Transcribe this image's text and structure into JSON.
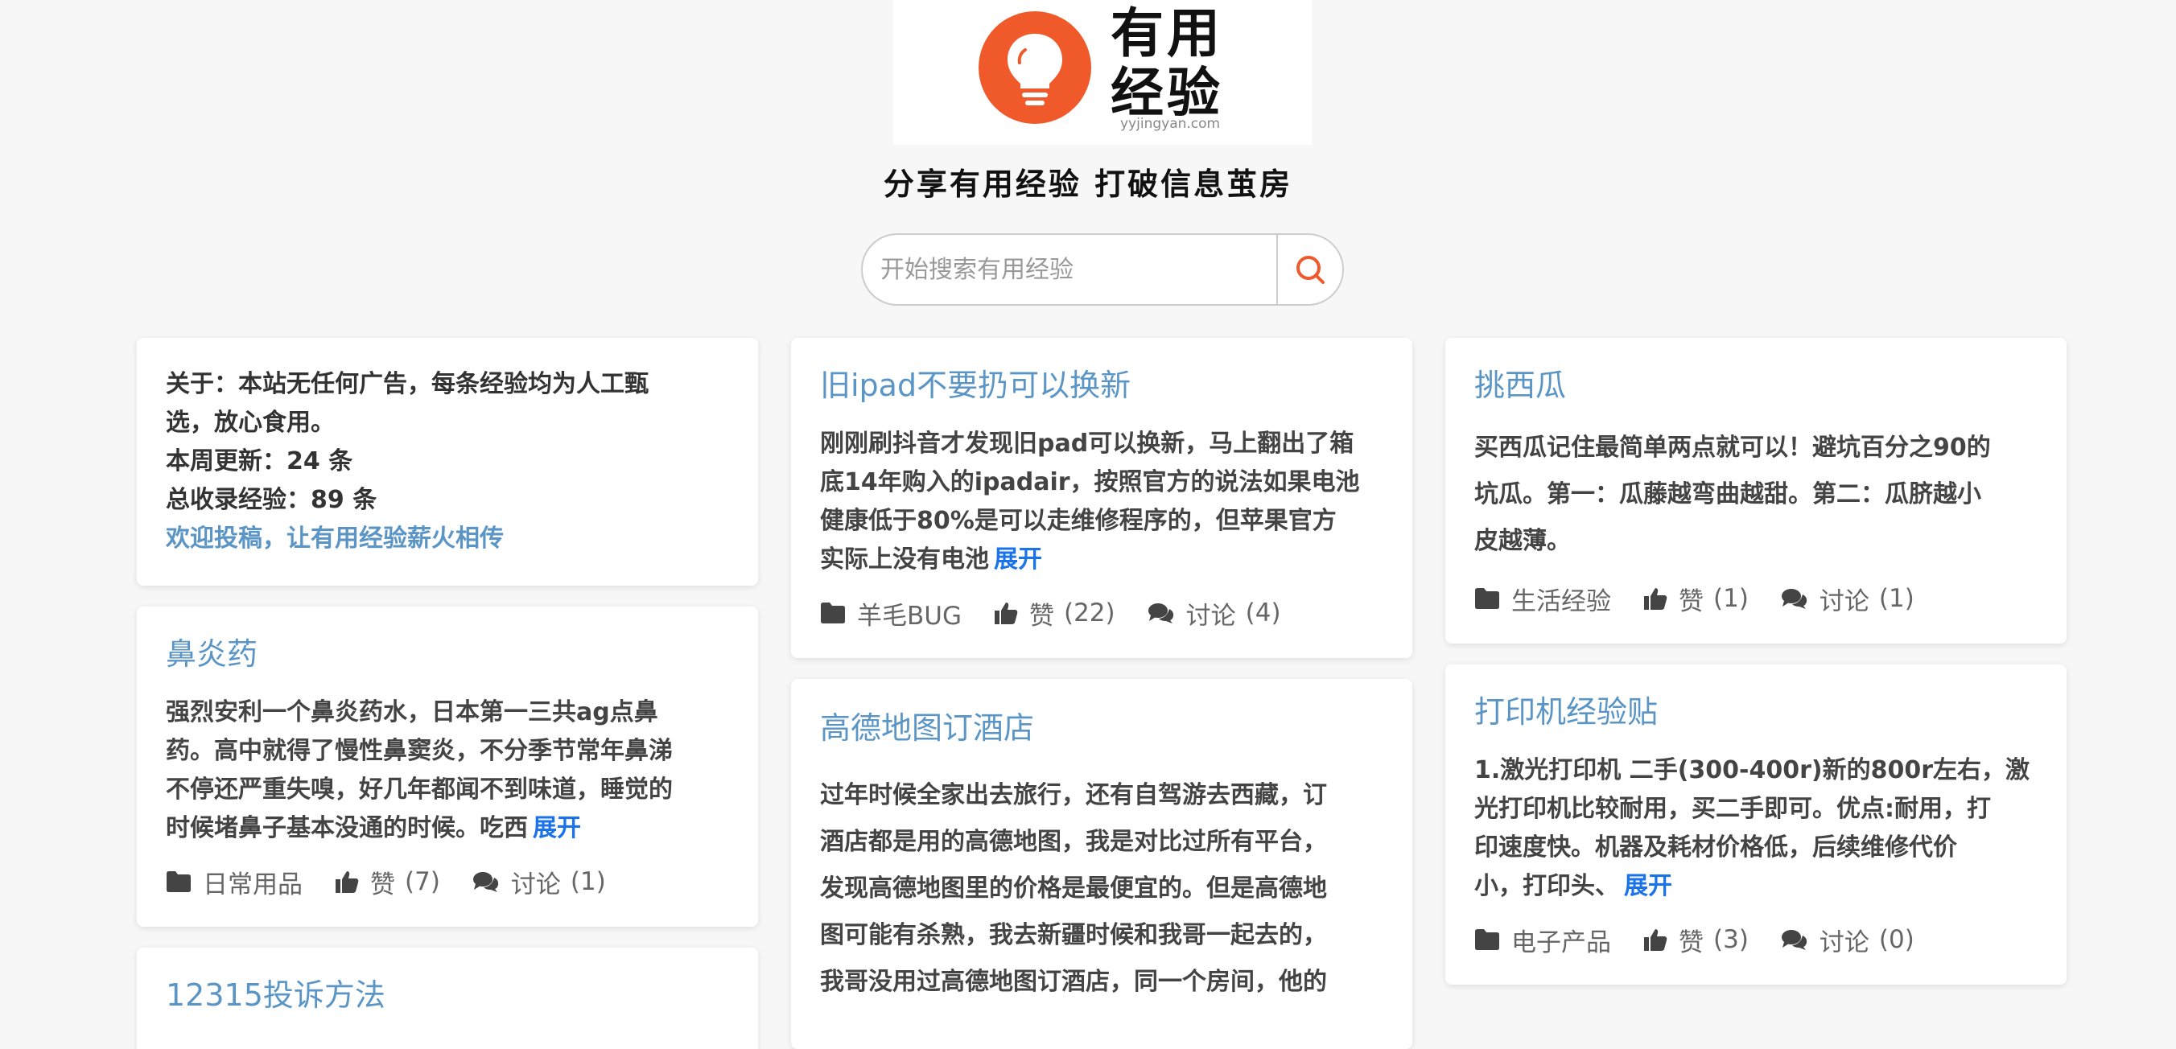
{
  "header": {
    "logo_line1": "有用",
    "logo_line2": "经验",
    "domain": "yyjingyan.com",
    "slogan": "分享有用经验 打破信息茧房"
  },
  "search": {
    "placeholder": "开始搜索有用经验",
    "icon": "search-icon"
  },
  "about": {
    "line1": "关于：本站无任何广告，每条经验均为人工甄",
    "line2": "选，放心食用。",
    "weekly": "本周更新：24 条",
    "total": "总收录经验：89 条",
    "link": "欢迎投稿，让有用经验薪火相传"
  },
  "cards": {
    "c1": {
      "title": "鼻炎药",
      "lines": [
        "强烈安利一个鼻炎药水，日本第一三共ag点鼻",
        "药。高中就得了慢性鼻窦炎，不分季节常年鼻涕",
        "不停还严重失嗅，好几年都闻不到味道，睡觉的",
        "时候堵鼻子基本没通的时候。吃西"
      ],
      "expand": "展开",
      "category": "日常用品",
      "like_label": "赞",
      "likes": "(7)",
      "comment_label": "讨论",
      "comments": "(1)"
    },
    "c2": {
      "title": "12315投诉方法"
    },
    "c3": {
      "title": "旧ipad不要扔可以换新",
      "lines": [
        "刚刚刷抖音才发现旧pad可以换新，马上翻出了箱",
        "底14年购入的ipadair，按照官方的说法如果电池",
        "健康低于80%是可以走维修程序的，但苹果官方",
        "实际上没有电池"
      ],
      "expand": "展开",
      "category": "羊毛BUG",
      "like_label": "赞",
      "likes": "(22)",
      "comment_label": "讨论",
      "comments": "(4)"
    },
    "c4": {
      "title": "高德地图订酒店",
      "lines": [
        "过年时候全家出去旅行，还有自驾游去西藏，订",
        "酒店都是用的高德地图，我是对比过所有平台，",
        "发现高德地图里的价格是最便宜的。但是高德地",
        "图可能有杀熟，我去新疆时候和我哥一起去的，",
        "我哥没用过高德地图订酒店，同一个房间，他的"
      ]
    },
    "c5": {
      "title": "挑西瓜",
      "lines": [
        "买西瓜记住最简单两点就可以！避坑百分之90的",
        "坑瓜。第一：瓜藤越弯曲越甜。第二：瓜脐越小",
        "皮越薄。"
      ],
      "category": "生活经验",
      "like_label": "赞",
      "likes": "(1)",
      "comment_label": "讨论",
      "comments": "(1)"
    },
    "c6": {
      "title": "打印机经验贴",
      "lines": [
        "1.激光打印机 二手(300-400r)新的800r左右，激",
        "光打印机比较耐用，买二手即可。优点:耐用，打",
        "印速度快。机器及耗材价格低，后续维修代价",
        "小，打印头、"
      ],
      "expand": "展开",
      "category": "电子产品",
      "like_label": "赞",
      "likes": "(3)",
      "comment_label": "讨论",
      "comments": "(0)"
    }
  },
  "colors": {
    "accent": "#f05a2b",
    "link": "#5a95c5",
    "expand": "#1a73e8"
  }
}
